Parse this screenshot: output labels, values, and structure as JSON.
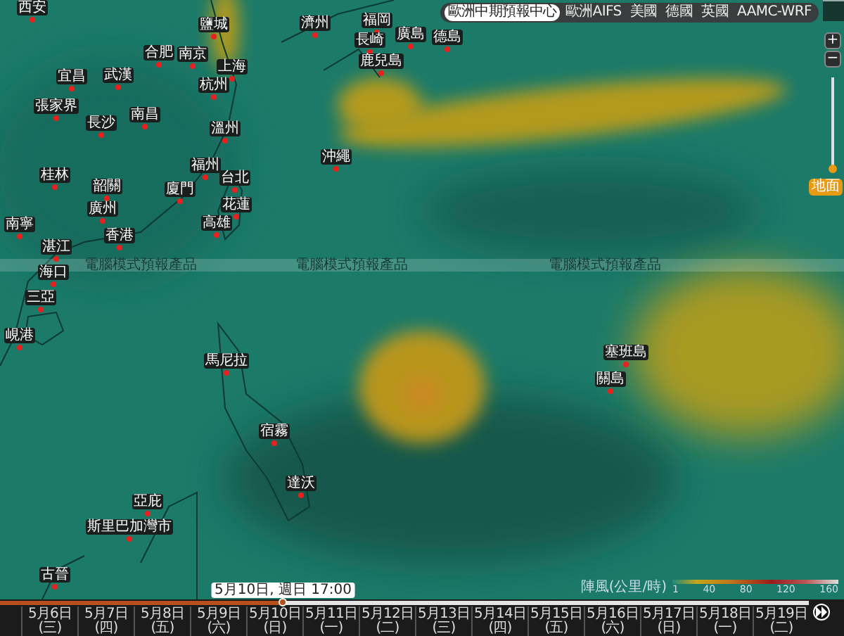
{
  "model_tabs": [
    {
      "label": "歐洲中期預報中心",
      "selected": true
    },
    {
      "label": "歐洲AIFS",
      "selected": false
    },
    {
      "label": "美國",
      "selected": false
    },
    {
      "label": "德國",
      "selected": false
    },
    {
      "label": "英國",
      "selected": false
    },
    {
      "label": "AAMC-WRF",
      "selected": false
    }
  ],
  "zoom_controls": {
    "zoom_in": "+",
    "zoom_out": "−"
  },
  "altitude_slider": {
    "level": 0,
    "label": "地面"
  },
  "band_labels": [
    "電腦模式預報產品",
    "電腦模式預報產品",
    "電腦模式預報產品"
  ],
  "cities": [
    {
      "name": "西安"
    },
    {
      "name": "鹽城"
    },
    {
      "name": "合肥"
    },
    {
      "name": "南京"
    },
    {
      "name": "宜昌"
    },
    {
      "name": "武漢"
    },
    {
      "name": "上海"
    },
    {
      "name": "杭州"
    },
    {
      "name": "張家界"
    },
    {
      "name": "長沙"
    },
    {
      "name": "南昌"
    },
    {
      "name": "溫州"
    },
    {
      "name": "福州"
    },
    {
      "name": "桂林"
    },
    {
      "name": "韶關"
    },
    {
      "name": "廈門"
    },
    {
      "name": "台北"
    },
    {
      "name": "花蓮"
    },
    {
      "name": "廣州"
    },
    {
      "name": "香港"
    },
    {
      "name": "高雄"
    },
    {
      "name": "南寧"
    },
    {
      "name": "湛江"
    },
    {
      "name": "海口"
    },
    {
      "name": "三亞"
    },
    {
      "name": "濟州"
    },
    {
      "name": "福岡"
    },
    {
      "name": "長崎"
    },
    {
      "name": "鹿兒島"
    },
    {
      "name": "廣島"
    },
    {
      "name": "德島"
    },
    {
      "name": "沖繩"
    },
    {
      "name": "峴港"
    },
    {
      "name": "馬尼拉"
    },
    {
      "name": "宿霧"
    },
    {
      "name": "達沃"
    },
    {
      "name": "亞庇"
    },
    {
      "name": "斯里巴加灣市"
    },
    {
      "name": "古晉"
    },
    {
      "name": "塞班島"
    },
    {
      "name": "關島"
    }
  ],
  "legend": {
    "title": "陣風(公里/時)",
    "ticks": [
      "1",
      "40",
      "80",
      "120",
      "160"
    ]
  },
  "timeline": {
    "level": 0.35,
    "tooltip": "5月10日, 週日 17:00",
    "dates": [
      "5月6日 (三)",
      "5月7日 (四)",
      "5月8日 (五)",
      "5月9日 (六)",
      "5月10日 (日)",
      "5月11日 (一)",
      "5月12日 (二)",
      "5月13日 (三)",
      "5月14日 (四)",
      "5月15日 (五)",
      "5月16日 (六)",
      "5月17日 (日)",
      "5月18日 (一)",
      "5月19日 (二)"
    ]
  }
}
